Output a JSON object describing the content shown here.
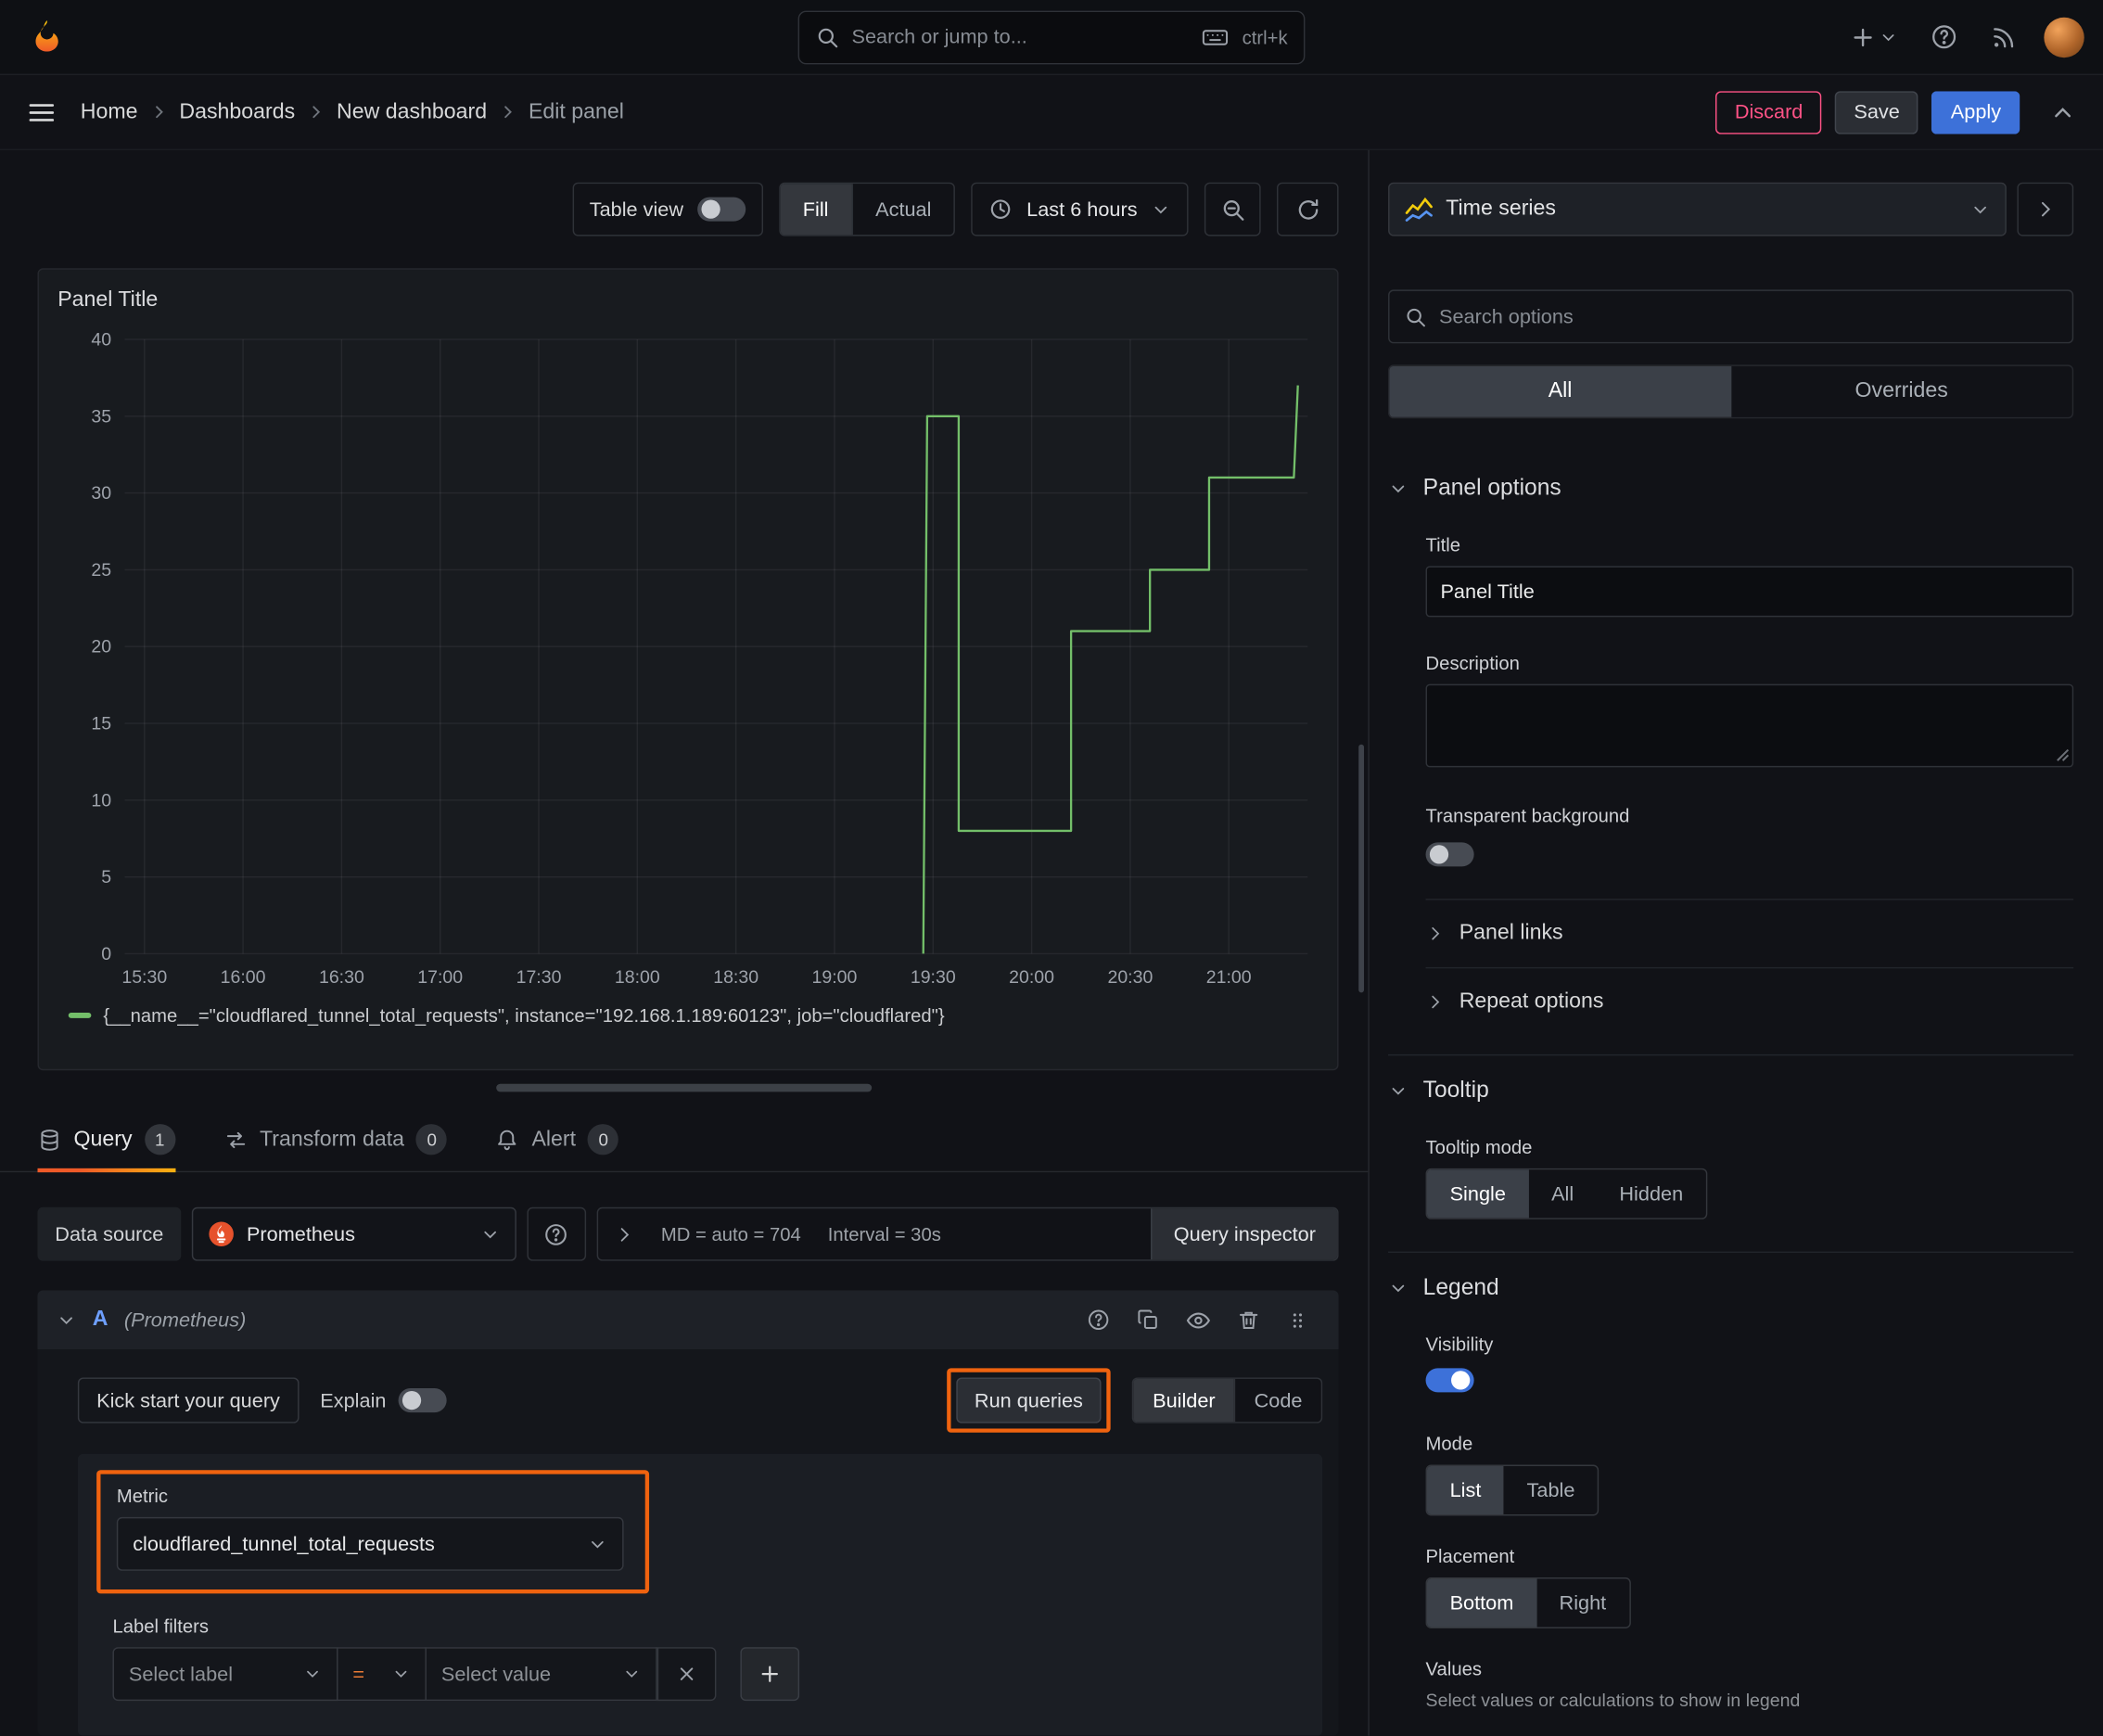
{
  "colors": {
    "accent_blue": "#3d71d9",
    "series_green": "#73bf69",
    "annotation_orange": "#f0630f",
    "destructive_pink": "#ff5286",
    "prometheus_orange": "#e6522c",
    "tab_underline_orange": "#f05a28",
    "background": "#111217",
    "panel_background": "#181b1f"
  },
  "topbar": {
    "search_placeholder": "Search or jump to...",
    "shortcut": "ctrl+k"
  },
  "nav": {
    "breadcrumbs": [
      "Home",
      "Dashboards",
      "New dashboard",
      "Edit panel"
    ],
    "discard": "Discard",
    "save": "Save",
    "apply": "Apply"
  },
  "toolbar": {
    "table_view": "Table view",
    "fill": "Fill",
    "actual": "Actual",
    "time_range": "Last 6 hours"
  },
  "panel": {
    "title": "Panel Title"
  },
  "chart_data": {
    "type": "line",
    "title": "Panel Title",
    "x_ticks": [
      "15:30",
      "16:00",
      "16:30",
      "17:00",
      "17:30",
      "18:00",
      "18:30",
      "19:00",
      "19:30",
      "20:00",
      "20:30",
      "21:00"
    ],
    "x_range_hours": [
      15.4,
      21.4
    ],
    "y_ticks": [
      0,
      5,
      10,
      15,
      20,
      25,
      30,
      35,
      40
    ],
    "ylim": [
      0,
      40
    ],
    "grid": true,
    "legend_position": "bottom",
    "series": [
      {
        "name": "{__name__=\"cloudflared_tunnel_total_requests\", instance=\"192.168.1.189:60123\", job=\"cloudflared\"}",
        "color": "#73bf69",
        "points": [
          [
            19.45,
            0
          ],
          [
            19.47,
            35
          ],
          [
            19.63,
            35
          ],
          [
            19.63,
            8
          ],
          [
            20.2,
            8
          ],
          [
            20.2,
            21
          ],
          [
            20.6,
            21
          ],
          [
            20.6,
            25
          ],
          [
            20.9,
            25
          ],
          [
            20.9,
            31
          ],
          [
            21.33,
            31
          ],
          [
            21.35,
            37
          ]
        ]
      }
    ]
  },
  "tabs": {
    "query": "Query",
    "query_count": "1",
    "transform": "Transform data",
    "transform_count": "0",
    "alert": "Alert",
    "alert_count": "0"
  },
  "query": {
    "datasource_label": "Data source",
    "datasource_name": "Prometheus",
    "md_stat": "MD = auto = 704",
    "interval_stat": "Interval = 30s",
    "inspector": "Query inspector",
    "ref_id": "A",
    "ref_ds": "(Prometheus)",
    "kickstart": "Kick start your query",
    "explain": "Explain",
    "run": "Run queries",
    "builder": "Builder",
    "code": "Code",
    "metric_label": "Metric",
    "metric_value": "cloudflared_tunnel_total_requests",
    "label_filters": "Label filters",
    "select_label": "Select label",
    "op": "=",
    "select_value": "Select value"
  },
  "options": {
    "viz_type": "Time series",
    "search_placeholder": "Search options",
    "tab_all": "All",
    "tab_overrides": "Overrides",
    "panel_options": "Panel options",
    "title_label": "Title",
    "title_value": "Panel Title",
    "description_label": "Description",
    "transparent_label": "Transparent background",
    "panel_links": "Panel links",
    "repeat_options": "Repeat options",
    "tooltip_section": "Tooltip",
    "tooltip_mode_label": "Tooltip mode",
    "tooltip_modes": [
      "Single",
      "All",
      "Hidden"
    ],
    "legend_section": "Legend",
    "visibility_label": "Visibility",
    "mode_label": "Mode",
    "legend_modes": [
      "List",
      "Table"
    ],
    "placement_label": "Placement",
    "placements": [
      "Bottom",
      "Right"
    ],
    "values_label": "Values",
    "values_help": "Select values or calculations to show in legend"
  }
}
